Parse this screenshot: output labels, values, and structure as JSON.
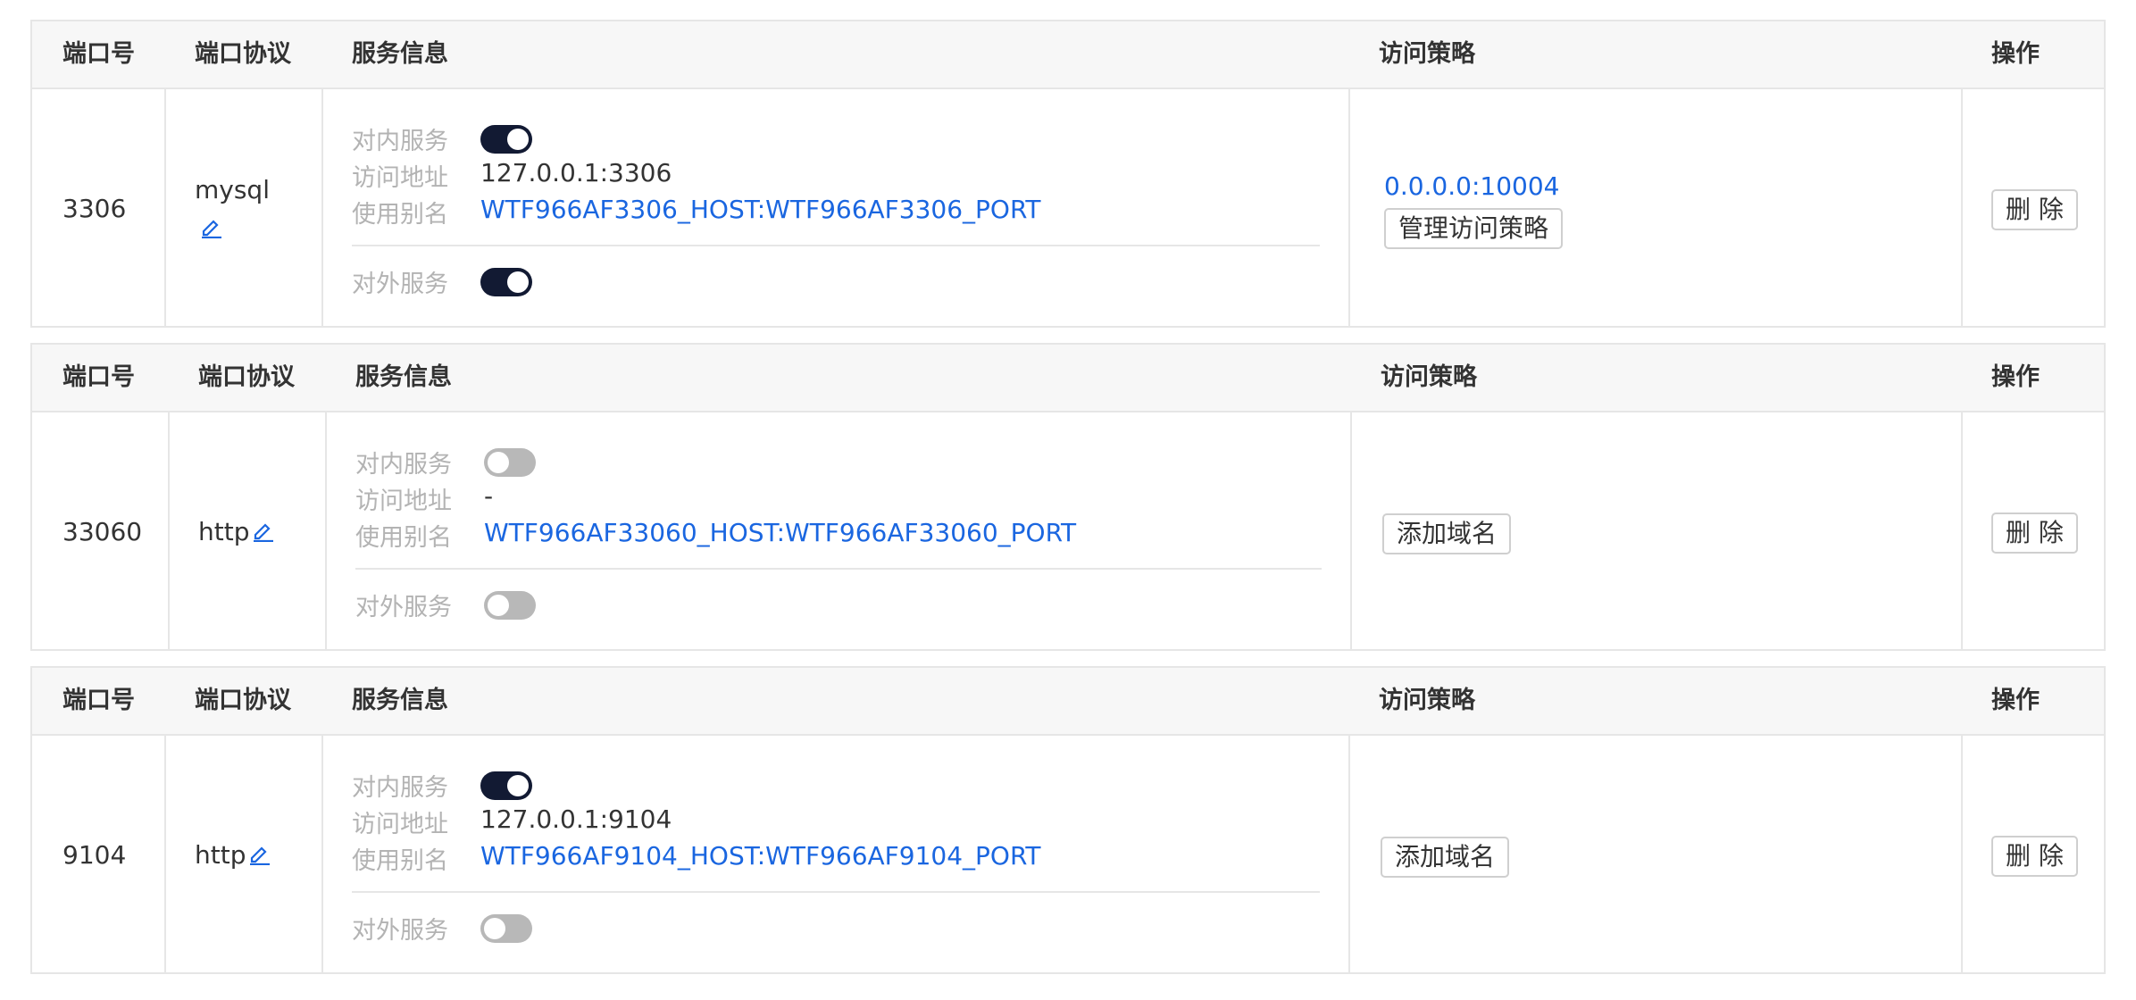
{
  "headers": {
    "port": "端口号",
    "protocol": "端口协议",
    "service": "服务信息",
    "policy": "访问策略",
    "action": "操作"
  },
  "labels": {
    "internal_service": "对内服务",
    "access_address": "访问地址",
    "alias": "使用别名",
    "external_service": "对外服务",
    "delete": "删 除"
  },
  "rows": [
    {
      "port": "3306",
      "protocol": "mysql",
      "internal_on": true,
      "address": "127.0.0.1:3306",
      "alias": "WTF966AF3306_HOST:WTF966AF3306_PORT",
      "external_on": true,
      "policy_link": "0.0.0.0:10004",
      "policy_button": "管理访问策略"
    },
    {
      "port": "33060",
      "protocol": "http",
      "internal_on": false,
      "address": "-",
      "alias": "WTF966AF33060_HOST:WTF966AF33060_PORT",
      "external_on": false,
      "policy_button": "添加域名"
    },
    {
      "port": "9104",
      "protocol": "http",
      "internal_on": true,
      "address": "127.0.0.1:9104",
      "alias": "WTF966AF9104_HOST:WTF966AF9104_PORT",
      "external_on": false,
      "policy_button": "添加域名"
    }
  ]
}
